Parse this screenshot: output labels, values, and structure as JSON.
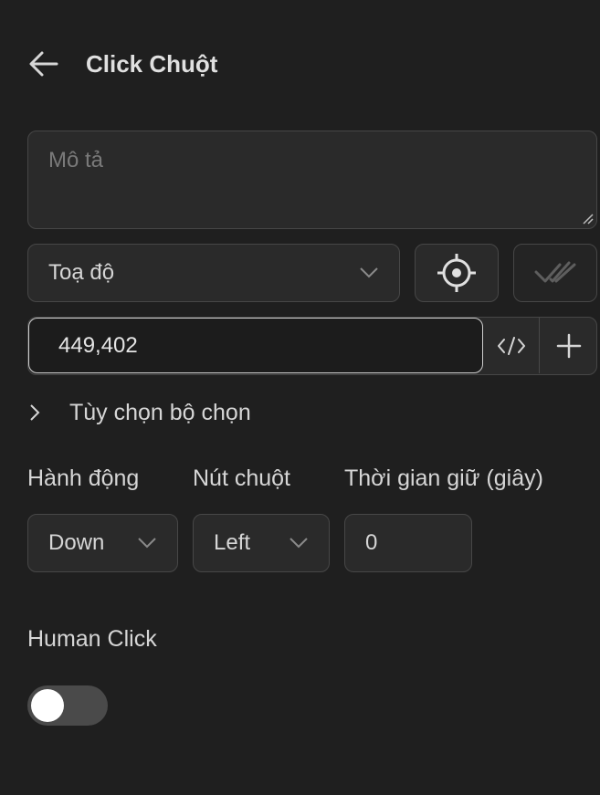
{
  "header": {
    "title": "Click Chuột"
  },
  "description": {
    "placeholder": "Mô tả",
    "value": ""
  },
  "target": {
    "selected": "Toạ độ"
  },
  "coordinate": {
    "value": "449,402"
  },
  "selector_options": {
    "label": "Tùy chọn bộ chọn",
    "expanded": false
  },
  "action": {
    "label": "Hành động",
    "selected": "Down"
  },
  "mouse_button": {
    "label": "Nút chuột",
    "selected": "Left"
  },
  "hold_time": {
    "label": "Thời gian giữ (giây)",
    "value": "0"
  },
  "human_click": {
    "label": "Human Click",
    "enabled": false
  },
  "icons": {
    "back": "arrow-left-icon",
    "target_dropdown": "chevron-down-icon",
    "locate": "crosshair-icon",
    "check": "double-check-icon",
    "code": "code-icon",
    "add": "plus-icon",
    "expand": "chevron-right-icon"
  },
  "colors": {
    "background": "#1f1f1f",
    "field": "#2a2a2a",
    "border": "#474747",
    "text": "#d6d6d6",
    "toggle_off": "#4a4a4a"
  }
}
